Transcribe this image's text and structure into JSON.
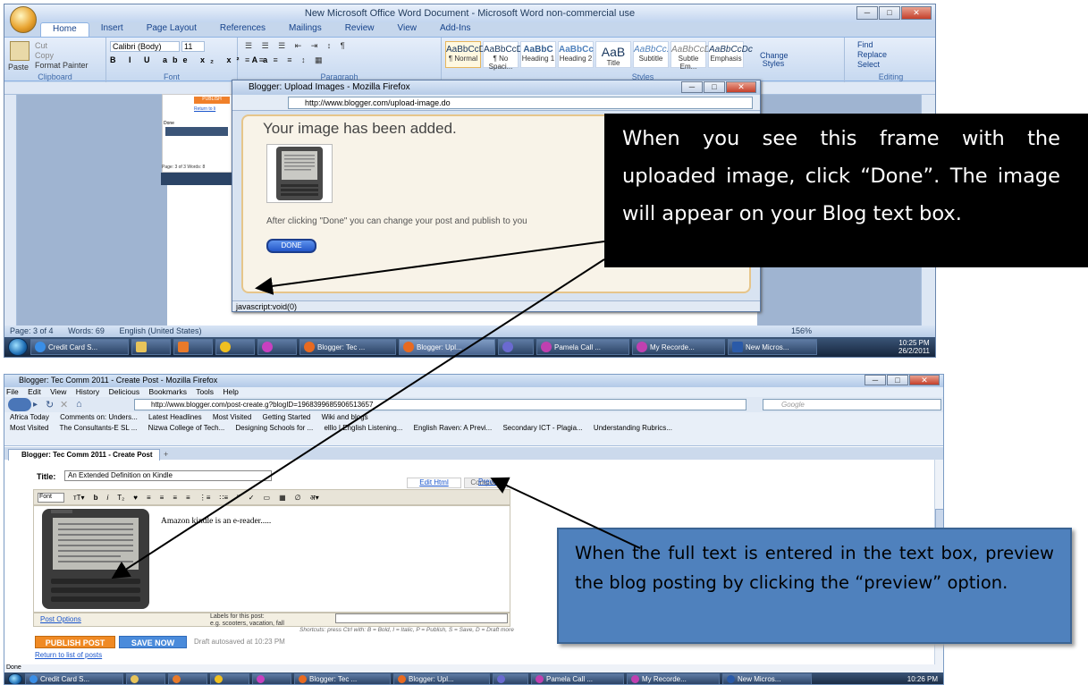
{
  "word": {
    "title": "New Microsoft Office Word Document - Microsoft Word non-commercial use",
    "tabs": [
      "Home",
      "Insert",
      "Page Layout",
      "References",
      "Mailings",
      "Review",
      "View",
      "Add-Ins"
    ],
    "clipboard": {
      "paste": "Paste",
      "cut": "Cut",
      "copy": "Copy",
      "format_painter": "Format Painter",
      "label": "Clipboard"
    },
    "font": {
      "name": "Calibri (Body)",
      "size": "11",
      "label": "Font"
    },
    "paragraph_label": "Paragraph",
    "styles": [
      {
        "preview": "AaBbCcDc",
        "name": "¶ Normal"
      },
      {
        "preview": "AaBbCcDc",
        "name": "¶ No Spaci..."
      },
      {
        "preview": "AaBbC",
        "name": "Heading 1"
      },
      {
        "preview": "AaBbCc",
        "name": "Heading 2"
      },
      {
        "preview": "AaB",
        "name": "Title"
      },
      {
        "preview": "AaBbCc.",
        "name": "Subtitle"
      },
      {
        "preview": "AaBbCcDc",
        "name": "Subtle Em..."
      },
      {
        "preview": "AaBbCcDc",
        "name": "Emphasis"
      }
    ],
    "styles_label": "Styles",
    "change_styles": "Change Styles",
    "editing": {
      "find": "Find",
      "replace": "Replace",
      "select": "Select",
      "label": "Editing"
    },
    "status": {
      "page": "Page: 3 of 4",
      "words": "Words: 69",
      "language": "English (United States)",
      "zoom": "156%"
    },
    "mini": {
      "publish": "PUBLISH",
      "return": "Return to li",
      "status": "Page: 3 of 3   Words: 8",
      "done": "Done"
    }
  },
  "popup": {
    "title": "Blogger: Upload Images - Mozilla Firefox",
    "url": "http://www.blogger.com/upload-image.do",
    "heading": "Your image has been added.",
    "after_text": "After clicking \"Done\" you can change your post and publish to you",
    "done_button": "DONE",
    "status": "javascript:void(0)"
  },
  "callout_top": "When you see this frame with the uploaded image, click “Done”. The image will appear on your Blog text box.",
  "callout_bottom": "When the full text is entered in the text box, preview the blog posting by clicking the “preview” option.",
  "taskbar": {
    "items": [
      "Credit Card S...",
      "",
      "",
      "",
      "",
      "Blogger: Tec ...",
      "Blogger: Upl...",
      "",
      "Pamela Call ...",
      "My Recorde...",
      "New Micros..."
    ],
    "time": "10:25 PM",
    "date": "26/2/2011",
    "time2": "10:26 PM"
  },
  "blogger": {
    "window_title": "Blogger: Tec Comm 2011 - Create Post - Mozilla Firefox",
    "menu": [
      "File",
      "Edit",
      "View",
      "History",
      "Delicious",
      "Bookmarks",
      "Tools",
      "Help"
    ],
    "url": "http://www.blogger.com/post-create.g?blogID=1968399685906513657",
    "search_placeholder": "Google",
    "bookmarks1": [
      "Africa Today",
      "Comments on: Unders...",
      "Latest Headlines",
      "Most Visited",
      "Getting Started",
      "Wiki and blogs"
    ],
    "bookmarks2": [
      "Most Visited",
      "The Consultants-E SL ...",
      "Nizwa College of Tech...",
      "Designing Schools for ...",
      "elllo | English Listening...",
      "English Raven: A Previ...",
      "Secondary ICT - Plagia...",
      "Understanding Rubrics..."
    ],
    "tab": "Blogger: Tec Comm 2011 - Create Post",
    "title_label": "Title:",
    "title_value": "An Extended Definition on Kindle",
    "edit_html": "Edit Html",
    "compose": "Compose",
    "font_select": "Font",
    "preview": "Preview",
    "editor_text": "Amazon kindle is an e-reader.....",
    "post_options": "Post Options",
    "labels_text": "Labels for this post:",
    "labels_hint": "e.g. scooters, vacation, fall",
    "shortcuts": "Shortcuts: press Ctrl with: B = Bold, I = Italic, P = Publish, S = Save, D = Draft more",
    "publish": "PUBLISH POST",
    "save": "SAVE NOW",
    "draft": "Draft autosaved at 10:23 PM",
    "return": "Return to list of posts",
    "status": "Done"
  }
}
